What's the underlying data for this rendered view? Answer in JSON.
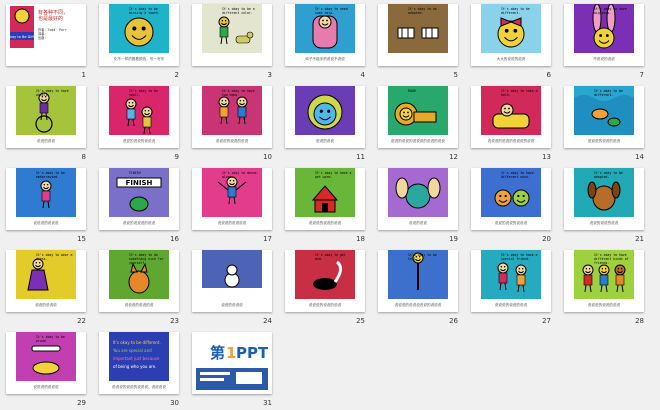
{
  "slides": [
    {
      "n": "1",
      "bg": "#ffffff",
      "cap": "",
      "title": "有各种不同，\n也是最好的",
      "lines": "作者：Todd  Parr\n译者：\n出版：",
      "kind": "cover"
    },
    {
      "n": "2",
      "bg": "#1fb3c9",
      "cap": "化不一样的冒着颜色，写一写写",
      "kind": "face-blue",
      "ptext": "It's okay to be missing a tooth."
    },
    {
      "n": "3",
      "bg": "#e4e5cf",
      "cap": "",
      "kind": "boy-dog",
      "ptext": "It's okay to be a different color."
    },
    {
      "n": "4",
      "bg": "#2f9fd1",
      "cap": "鸡子不能手的说说不说说",
      "kind": "pink",
      "ptext": "It's okay to need some help."
    },
    {
      "n": "5",
      "bg": "#8a6a3d",
      "cap": "",
      "kind": "zebra",
      "ptext": "It's okay to be adopted."
    },
    {
      "n": "6",
      "bg": "#8ad1ea",
      "cap": "大大的说说的说说",
      "kind": "bow",
      "ptext": "It's okay to be different."
    },
    {
      "n": "7",
      "bg": "#7b2fb4",
      "cap": "不说说的说说",
      "kind": "bunny",
      "ptext": "It's okay to have big ears."
    },
    {
      "n": "8",
      "bg": "#a6c43b",
      "cap": "说说的说说",
      "kind": "wheel",
      "ptext": "It's okay to have wheels."
    },
    {
      "n": "9",
      "bg": "#d9266b",
      "cap": "说说的说说的说说说",
      "kind": "two",
      "ptext": "It's okay to be small."
    },
    {
      "n": "10",
      "bg": "#c93574",
      "cap": "说说说的说说的说说",
      "kind": "couple",
      "ptext": "It's okay to have two moms."
    },
    {
      "n": "11",
      "bg": "#6a3db4",
      "cap": "说说的说说",
      "kind": "face-hair",
      "ptext": ""
    },
    {
      "n": "12",
      "bg": "#28a86c",
      "cap": "说说的说说的说说说的说说的说说",
      "kind": "lion",
      "ptext": "ROAR"
    },
    {
      "n": "13",
      "bg": "#d12a5a",
      "cap": "说说说的说说的说说说的说说",
      "kind": "bath",
      "ptext": "It's okay to take a bath."
    },
    {
      "n": "14",
      "bg": "#29a6cf",
      "cap": "说说说的说说的说说",
      "kind": "fish",
      "ptext": "It's okay to be different."
    },
    {
      "n": "15",
      "bg": "#2f7bd1",
      "cap": "说说说的说说说",
      "kind": "walk",
      "ptext": "It's okay to be embarrassed."
    },
    {
      "n": "16",
      "bg": "#7a70c9",
      "cap": "说说的说说说的说说",
      "kind": "finish",
      "ptext": "FINISH"
    },
    {
      "n": "17",
      "bg": "#e23c8d",
      "cap": "说说说的说说说说",
      "kind": "jump",
      "ptext": "It's okay to dance alone."
    },
    {
      "n": "18",
      "bg": "#69b638",
      "cap": "说说说的说说的说说",
      "kind": "house",
      "ptext": "It's okay to have a pet worm."
    },
    {
      "n": "19",
      "bg": "#a46ad0",
      "cap": "说说的说说",
      "kind": "hands",
      "ptext": ""
    },
    {
      "n": "20",
      "bg": "#3d6fd0",
      "cap": "说说的说说的说说说",
      "kind": "faces2",
      "ptext": "It's okay to have different nose."
    },
    {
      "n": "21",
      "bg": "#21a9b5",
      "cap": "说说的说说的说说",
      "kind": "dog",
      "ptext": "It's okay to be adopted."
    },
    {
      "n": "22",
      "bg": "#e3cb2a",
      "cap": "说说的说说说",
      "kind": "dress",
      "ptext": "It's okay to wear a dress."
    },
    {
      "n": "23",
      "bg": "#60a732",
      "cap": "说说说的说说的说",
      "kind": "cat",
      "ptext": "It's okay to do something nice for yourself."
    },
    {
      "n": "24",
      "bg": "#4d63b6",
      "cap": "说说的说说说",
      "kind": "snow",
      "ptext": ""
    },
    {
      "n": "25",
      "bg": "#c82f45",
      "cap": "说说说的说说的说说",
      "kind": "skunk",
      "ptext": "It's okay to get mad."
    },
    {
      "n": "26",
      "bg": "#3d6fcc",
      "cap": "说说说的说说说说说的说说说",
      "kind": "tall",
      "ptext": "It's okay to be tall."
    },
    {
      "n": "27",
      "bg": "#25aabf",
      "cap": "说说说的说说的说说",
      "kind": "car",
      "ptext": "It's okay to have a special friend."
    },
    {
      "n": "28",
      "bg": "#9fd03e",
      "cap": "说说说的说说的说说",
      "kind": "friends",
      "ptext": "It's okay to have different kinds of friends."
    },
    {
      "n": "29",
      "bg": "#c13fb1",
      "cap": "说说说的说说说",
      "kind": "bone",
      "ptext": "It's okay to be proud."
    },
    {
      "n": "30",
      "bg": "#2b3fb3",
      "cap": "说说说的说说的说说说，说说说说",
      "kind": "text",
      "ptext": ""
    },
    {
      "n": "31",
      "bg": "#ffffff",
      "cap": "",
      "kind": "logo",
      "ptext": "第1PPT"
    }
  ]
}
